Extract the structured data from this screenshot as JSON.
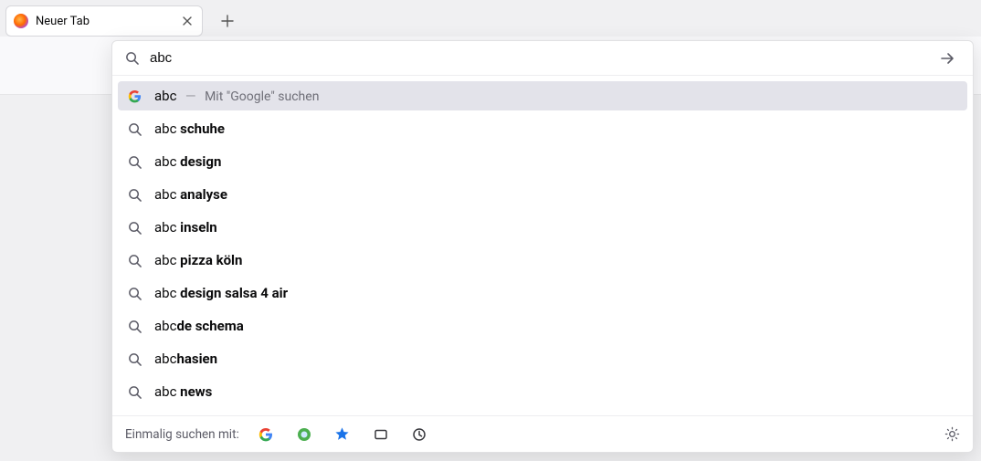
{
  "tab": {
    "title": "Neuer Tab"
  },
  "search": {
    "value": "abc"
  },
  "topSuggestion": {
    "prefix": "abc",
    "hint": "Mit \"Google\" suchen"
  },
  "suggestions": [
    {
      "prefix": "abc ",
      "bold": "schuhe"
    },
    {
      "prefix": "abc ",
      "bold": "design"
    },
    {
      "prefix": "abc ",
      "bold": "analyse"
    },
    {
      "prefix": "abc ",
      "bold": "inseln"
    },
    {
      "prefix": "abc ",
      "bold": "pizza köln"
    },
    {
      "prefix": "abc ",
      "bold": "design salsa 4 air"
    },
    {
      "prefix": "abc",
      "bold": "de schema"
    },
    {
      "prefix": "abc",
      "bold": "hasien"
    },
    {
      "prefix": "abc ",
      "bold": "news"
    }
  ],
  "footer": {
    "label": "Einmalig suchen mit:"
  }
}
